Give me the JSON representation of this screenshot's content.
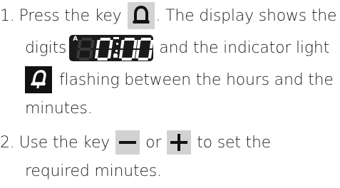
{
  "steps": [
    {
      "number": "1.",
      "line1_a": "Press the key",
      "line1_b": ". The display shows the",
      "line2_a": "digits",
      "line2_b": "and the indicator light",
      "line3": "flashing between the hours and the",
      "line4": "minutes."
    },
    {
      "number": "2.",
      "line1_a": "Use the key",
      "line1_b": "or",
      "line1_c": "to set the",
      "line2": "required minutes."
    }
  ],
  "display": {
    "indicator_letter": "A"
  },
  "icons": {
    "bell_key": "bell-icon",
    "oven_display": "digit-display-icon",
    "indicator": "bell-indicator-icon",
    "minus_key": "minus-icon",
    "plus_key": "plus-icon"
  },
  "colors": {
    "key_bg": "#d2d2d2",
    "display_bg": "#1a1a1a",
    "text": "#1e1e1e"
  }
}
